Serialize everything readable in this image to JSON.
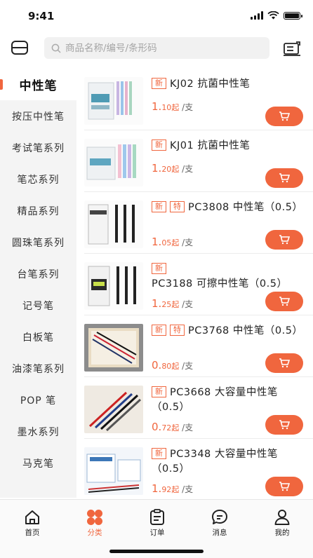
{
  "status_bar": {
    "time": "9:41"
  },
  "search": {
    "placeholder": "商品名称/编号/条形码"
  },
  "sidebar": {
    "items": [
      {
        "label": "中性笔",
        "active": true
      },
      {
        "label": "按压中性笔"
      },
      {
        "label": "考试笔系列"
      },
      {
        "label": "笔芯系列"
      },
      {
        "label": "精品系列"
      },
      {
        "label": "圆珠笔系列"
      },
      {
        "label": "台笔系列"
      },
      {
        "label": "记号笔"
      },
      {
        "label": "白板笔"
      },
      {
        "label": "油漆笔系列"
      },
      {
        "label": "POP 笔"
      },
      {
        "label": "墨水系列"
      },
      {
        "label": "马克笔"
      }
    ]
  },
  "products": [
    {
      "tags": [
        "新"
      ],
      "name": "KJ02 抗菌中性笔",
      "price_int": "1.",
      "price_dec": "10",
      "unit_prefix": "起",
      "unit": "/支"
    },
    {
      "tags": [
        "新"
      ],
      "name": "KJ01 抗菌中性笔",
      "price_int": "1.",
      "price_dec": "20",
      "unit_prefix": "起",
      "unit": "/支"
    },
    {
      "tags": [
        "新",
        "特"
      ],
      "name": "PC3808 中性笔（0.5）",
      "price_int": "1.",
      "price_dec": "05",
      "unit_prefix": "起",
      "unit": "/支"
    },
    {
      "tags": [
        "新"
      ],
      "name": "PC3188 可擦中性笔（0.5）",
      "price_int": "1.",
      "price_dec": "25",
      "unit_prefix": "起",
      "unit": "/支"
    },
    {
      "tags": [
        "新",
        "特"
      ],
      "name": "PC3768 中性笔（0.5）",
      "price_int": "0.",
      "price_dec": "80",
      "unit_prefix": "起",
      "unit": "/支"
    },
    {
      "tags": [
        "新"
      ],
      "name": "PC3668 大容量中性笔（0.5）",
      "price_int": "0.",
      "price_dec": "72",
      "unit_prefix": "起",
      "unit": "/支"
    },
    {
      "tags": [
        "新"
      ],
      "name": "PC3348 大容量中性笔（0.5）",
      "price_int": "1.",
      "price_dec": "92",
      "unit_prefix": "起",
      "unit": "/支"
    }
  ],
  "tabs": [
    {
      "label": "首页",
      "icon": "home-icon"
    },
    {
      "label": "分类",
      "icon": "category-icon",
      "active": true
    },
    {
      "label": "订单",
      "icon": "order-icon"
    },
    {
      "label": "消息",
      "icon": "message-icon"
    },
    {
      "label": "我的",
      "icon": "profile-icon"
    }
  ],
  "colors": {
    "accent": "#f0663e",
    "sidebar_bg": "#f4f4f4"
  }
}
